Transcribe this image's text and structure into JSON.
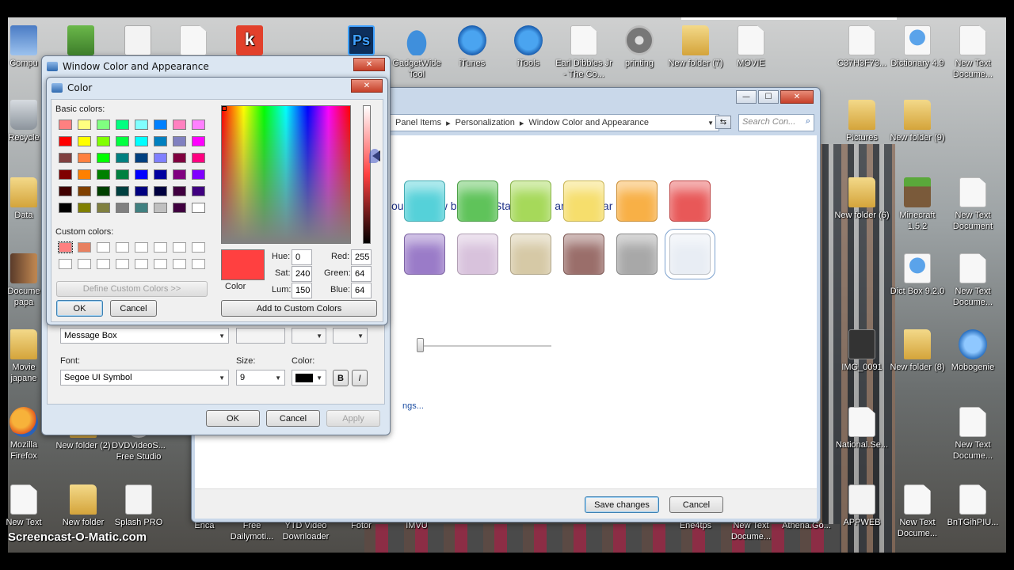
{
  "desktop": {
    "left_icons": [
      {
        "label": "Compu",
        "icon": "computer-icon",
        "kind": "pc"
      },
      {
        "label": "Recycle",
        "icon": "recycle-bin-icon",
        "kind": "trash"
      },
      {
        "label": "Data",
        "icon": "folder-icon",
        "kind": "folder"
      },
      {
        "label": "Docume papa",
        "icon": "folder-icon",
        "kind": "film"
      },
      {
        "label": "Movie japane",
        "icon": "folder-icon",
        "kind": "folder"
      },
      {
        "label": "Mozilla Firefox",
        "icon": "firefox-icon",
        "kind": "ff"
      },
      {
        "label": "New Text",
        "icon": "text-document-icon",
        "kind": "doc"
      }
    ],
    "col2_icons": [
      {
        "label": "New folder (2)",
        "icon": "folder-icon",
        "kind": "folder"
      },
      {
        "label": "New folder",
        "icon": "folder-icon",
        "kind": "folder"
      }
    ],
    "col3_icons": [
      {
        "label": "DVDVideoS... Free Studio",
        "icon": "dvd-studio-icon",
        "kind": "disc"
      },
      {
        "label": "Splash PRO",
        "icon": "splash-pro-icon",
        "kind": "smart"
      }
    ],
    "top_icons": [
      {
        "label": "GadgetWide Tool",
        "icon": "cloud-icon",
        "kind": "cloud"
      },
      {
        "label": "iTunes",
        "icon": "itunes-icon",
        "kind": "blue"
      },
      {
        "label": "iTools",
        "icon": "itools-icon",
        "kind": "blue"
      },
      {
        "label": "Earl Dibbles Jr - The Co...",
        "icon": "mp3-file-icon",
        "kind": "doc"
      },
      {
        "label": "printing",
        "icon": "printer-icon",
        "kind": "disc"
      },
      {
        "label": "New folder (7)",
        "icon": "folder-icon",
        "kind": "folder"
      },
      {
        "label": "MOVIE",
        "icon": "text-document-icon",
        "kind": "doc"
      },
      {
        "label": "C37H3F73...",
        "icon": "text-document-icon",
        "kind": "doc"
      }
    ],
    "right_col1": [
      {
        "label": "Dictionary 4.9",
        "icon": "ipa-file-icon",
        "kind": "ipa"
      },
      {
        "label": "New folder (9)",
        "icon": "folder-icon",
        "kind": "folder"
      },
      {
        "label": "Minecraft 1.5.2",
        "icon": "minecraft-icon",
        "kind": "mc"
      },
      {
        "label": "Dict Box 9.2.0",
        "icon": "ipa-file-icon",
        "kind": "ipa"
      },
      {
        "label": "New folder (8)",
        "icon": "folder-icon",
        "kind": "folder"
      },
      {
        "label": "New Text Docume...",
        "icon": "text-document-icon",
        "kind": "doc"
      }
    ],
    "right_col2": [
      {
        "label": "New Text Docume...",
        "icon": "text-document-icon",
        "kind": "doc"
      },
      {
        "label": "New Text Document",
        "icon": "text-document-icon",
        "kind": "doc"
      },
      {
        "label": "New Text Docume...",
        "icon": "text-document-icon",
        "kind": "doc"
      },
      {
        "label": "Mobogenie",
        "icon": "mobogenie-icon",
        "kind": "mobo"
      },
      {
        "label": "New Text Docume...",
        "icon": "text-document-icon",
        "kind": "doc"
      },
      {
        "label": "BnTGihPIU...",
        "icon": "text-document-icon",
        "kind": "doc"
      }
    ],
    "mid_right_icons": [
      {
        "label": "Pictures",
        "icon": "folder-icon",
        "kind": "folder"
      },
      {
        "label": "New folder (6)",
        "icon": "folder-icon",
        "kind": "folder"
      },
      {
        "label": "IMG_0091",
        "icon": "image-file-icon",
        "kind": "dark"
      },
      {
        "label": "National.Se...",
        "icon": "text-document-icon",
        "kind": "doc"
      },
      {
        "label": "APPWEB",
        "icon": "smart-icon",
        "kind": "smart"
      }
    ],
    "bottom_partial": [
      "Enca",
      "Free Dailymoti...",
      "YTD Video Downloader",
      "Fotor",
      "IMVU",
      "Ene4tps",
      "New Text Docume...",
      "Athena.Go...",
      "BnTGihPIU..."
    ],
    "watermark": "Screencast-O-Matic.com",
    "top_row_apps": [
      {
        "icon": "webcam-icon",
        "kind": "green"
      },
      {
        "icon": "smart-bro-icon",
        "kind": "smart"
      },
      {
        "icon": "text-document-icon",
        "kind": "doc"
      },
      {
        "icon": "kingsoft-icon",
        "kind": "red"
      },
      {
        "icon": "photoshop-icon",
        "kind": "ps"
      }
    ],
    "ps_label": "Ps",
    "k_label": "k"
  },
  "personalization": {
    "address_segments": [
      "Panel Items",
      "Personalization",
      "Window Color and Appearance"
    ],
    "search_placeholder": "Search Con...",
    "heading": "our window borders, Start menu, and taskbar",
    "swatches_row1": [
      "#55d1d9",
      "#5fc35a",
      "#a6d95a",
      "#f6de6c",
      "#f8b046",
      "#e85858"
    ],
    "swatches_row2": [
      "#9a7bc8",
      "#d8c2dc",
      "#d6c9a6",
      "#9a6e6a",
      "#a8a8a8",
      "#e8edf4"
    ],
    "link_text": "ngs...",
    "save_button": "Save changes",
    "cancel_button": "Cancel"
  },
  "appearance_dialog": {
    "title": "Window Color and Appearance",
    "item_value": "Message Box",
    "font_label": "Font:",
    "font_value": "Segoe UI Symbol",
    "size_label": "Size:",
    "size_value": "9",
    "color_label": "Color:",
    "bold_label": "B",
    "italic_label": "I",
    "ok": "OK",
    "cancel": "Cancel",
    "apply": "Apply"
  },
  "color_dialog": {
    "title": "Color",
    "basic_colors_label": "Basic colors:",
    "custom_colors_label": "Custom colors:",
    "basic_colors": [
      "#ff8080",
      "#ffff80",
      "#80ff80",
      "#00ff80",
      "#80ffff",
      "#0080ff",
      "#ff80c0",
      "#ff80ff",
      "#ff0000",
      "#ffff00",
      "#80ff00",
      "#00ff40",
      "#00ffff",
      "#0080c0",
      "#8080c0",
      "#ff00ff",
      "#804040",
      "#ff8040",
      "#00ff00",
      "#008080",
      "#004080",
      "#8080ff",
      "#800040",
      "#ff0080",
      "#800000",
      "#ff8000",
      "#008000",
      "#008040",
      "#0000ff",
      "#0000a0",
      "#800080",
      "#8000ff",
      "#400000",
      "#804000",
      "#004000",
      "#004040",
      "#000080",
      "#000040",
      "#400040",
      "#400080",
      "#000000",
      "#808000",
      "#808040",
      "#808080",
      "#408080",
      "#c0c0c0",
      "#400040",
      "#ffffff"
    ],
    "custom_colors": [
      "#ff8080",
      "#e88060",
      "#ffffff",
      "#ffffff",
      "#ffffff",
      "#ffffff",
      "#ffffff",
      "#ffffff",
      "#ffffff",
      "#ffffff",
      "#ffffff",
      "#ffffff",
      "#ffffff",
      "#ffffff",
      "#ffffff",
      "#ffffff"
    ],
    "define_custom": "Define Custom Colors >>",
    "ok": "OK",
    "cancel": "Cancel",
    "preview_label": "Color",
    "preview_color": "#ff4040",
    "hue_label": "Hue:",
    "hue": "0",
    "sat_label": "Sat:",
    "sat": "240",
    "lum_label": "Lum:",
    "lum": "150",
    "red_label": "Red:",
    "red": "255",
    "green_label": "Green:",
    "green": "64",
    "blue_label": "Blue:",
    "blue": "64",
    "add_custom": "Add to Custom Colors"
  }
}
